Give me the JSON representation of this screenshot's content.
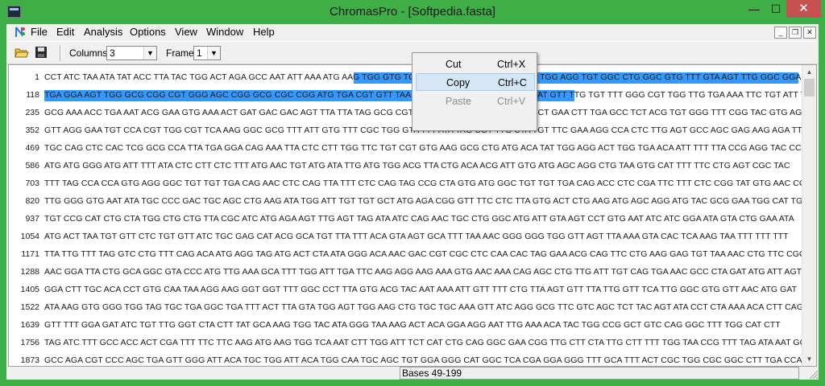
{
  "window": {
    "title": "ChromasPro - [Softpedia.fasta]"
  },
  "titlebar_buttons": {
    "minimize": "—",
    "maximize": "☐",
    "close": "✕"
  },
  "menubar": {
    "items": [
      "File",
      "Edit",
      "Analysis",
      "Options",
      "View",
      "Window",
      "Help"
    ],
    "mdi_buttons": {
      "minimize": "_",
      "restore": "❐",
      "close": "✕"
    }
  },
  "toolbar": {
    "columns_label": "Columns",
    "columns_value": "3",
    "frame_label": "Frame",
    "frame_value": "1",
    "combo_arrow": "▼"
  },
  "sequence": {
    "rows": [
      {
        "num": "1",
        "text": "CCT ATC TAA ATA TAT ACC TTA TAC TGG ACT AGA GCC AAT ATT AAA ATG AAG TGG GTG TCC CGA TGT ACT TTG ATT CGG TGG AGG TGT GGC CTG GGC GTG TTT GTA AGT TTG GGC GGA"
      },
      {
        "num": "118",
        "text": "TGA GGA AGT TGG GCG CGG CGT GGG AGC CGG GCG CGC CGG ATG TGA CGT GTT TAA CGC CCG TGA CAT AGT GCT TAT GTT TTG TGT TTT GGG CGT TGG TTG TGA AAA TTC TGT ATT TTT GGC"
      },
      {
        "num": "235",
        "text": "GCG AAA ACC TGA AAT ACG GAA GTG AAA ACT GAT GAC GAC AGT TTA TTA TAG GCG CGT AAT ATT TGT CTA GGG CCG CCT GAA CTT TGA GCC TCT ACG TGT GGG TTT CGG TAC GTG AGT"
      },
      {
        "num": "352",
        "text": "GTT AGG GAA TGT CCA CGT TGG CGT TCA AAG GGC GCG TTT ATT GTG TTT CGC TGG GTA TTT ATA TAG CGT TTG CTA TGT TTC GAA AGG CCA CTC TTG AGT GCC AGC GAG AAG AGA TTT CTC"
      },
      {
        "num": "469",
        "text": "TGC CAG CTC CAC TCG GCG CCA TTA TGA GGA CAG AAA TTA CTC CTT TGG TTC TGT CGT GTG AAG GCG CTG ATG ACA TAT TGG AGG ACT TGG TGA ACA ATT TTT TTA CCG AGG TAC CCG"
      },
      {
        "num": "586",
        "text": "ATG ATG GGG ATG ATT TTT ATA CTC CTT CTC TTT ATG AAC TGT ATG ATA TTG ATG TGG ACG TTA CTG ACA ACG ATT GTG ATG AGC AGG CTG TAA GTG CAT TTT TTC CTG AGT CGC TAC"
      },
      {
        "num": "703",
        "text": "TTT TAG CCA CCA GTG AGG GGC TGT TGT TGA CAG AAC CTC CAG TTA TTT CTC CAG TAG CCG CTA GTG ATG GGC TGT TGT TGA CAG ACC CTC CGA TTC TTT CTC CGG TAT GTG AAC CCG"
      },
      {
        "num": "820",
        "text": "TTG GGG GTG AAT ATA TGC CCC GAC TGC AGC CTG AAG ATA TGG ATT TGT TGT GCT ATG AGA CGG GTT TTC CTC TTA GTG ACT CTG AAG ATG AGC AGG ATG TAC GCG GAA TGG CAT TGG"
      },
      {
        "num": "937",
        "text": "TGT CCG CAT CTG CTA TGG CTG CTG TTA CGC ATC ATG AGA AGT TTG AGT TAG ATA ATC CAG AAC TGC CTG GGC ATG ATT GTA AGT CCT GTG AAT ATC ATC GGA ATA GTA CTG GAA ATA"
      },
      {
        "num": "1054",
        "text": "ATG ACT TAA TGT GTT CTC TGT GTT ATC TGC GAG CAT ACG GCA TGT TTA TTT ACA GTA AGT GCA TTT TAA AAC GGG GGG TGG GTT AGT TTA AAA GTA CAC TCA AAG TAA TTT TTT TTT"
      },
      {
        "num": "1171",
        "text": "TTA TTG TTT TAG GTC CTG TTT CAG ACA ATG AGG TAG ATG ACT CTA ATA GGG ACA AAC GAC CGT CGC CTC CAA CAC TAG GAA ACG CAG TTC CTG AAG GAG TGT TAA AAC CTG TTC CGC"
      },
      {
        "num": "1288",
        "text": "AAC GGA TTA CTG GCA GGC GTA CCC ATG TTG AAA GCA TTT TGG ATT TGA TTC AAG AGG AAG AAA GTG AAC AAA CAG AGC CTG TTG ATT TGT CAG TGA AAC GCC CTA GAT ATG ATT AGT"
      },
      {
        "num": "1405",
        "text": "GGA CTT TGC ACA CCT GTG CAA TAA AGG AAG GGT GGT TTT GGC CCT TTA GTG ACG TAC AAT AAA ATT GTT TTT CTG TTA AGT GTT TTA TTG GTT TCA TTG GGC GTG GTT AAC ATG GAT"
      },
      {
        "num": "1522",
        "text": "ATA AAG GTG GGG TGG TAG TGC TGA GGC TGA TTT ACT TTA GTA TGG AGT TGG AAG CTG TGC TGC AAA GTT ATC AGG GCG TTC GTC AGC TCT TAC AGT ATA CCT CTA AAA ACA CTT CAG"
      },
      {
        "num": "1639",
        "text": "GTT TTT GGA GAT ATC TGT TTG GGT CTA CTT TAT GCA AAG TGG TAC ATA GGG TAA AAG ACT ACA GGA AGG AAT TTG AAA ACA TAC TGG CCG GCT GTC CAG GGC TTT TGG CAT CTT"
      },
      {
        "num": "1756",
        "text": "TAG ATC TTT GCC ACC ACT CGA TTT TTC TTC AAG ATG AAG TGG TCA AAT CTT TGG ATT TCT CAT CTG CAG GGC GAA CGG TTG CTT CTA TTG CTT TTT TGG TAA CCG TTT TAG ATA AAT GGA"
      },
      {
        "num": "1873",
        "text": "GCC AGA CGT CCC AGC TGA GTT GGG ATT ACA TGC TGG ATT ACA TGG CAA TGC AGC TGT GGA GGG CAT GGC TCA CGA GGA GGG TTT GCA TTT ACT CGC TGG CGC GGC CTT TGA CCA TGC"
      }
    ]
  },
  "context_menu": {
    "items": [
      {
        "label": "Cut",
        "shortcut": "Ctrl+X"
      },
      {
        "label": "Copy",
        "shortcut": "Ctrl+C"
      },
      {
        "label": "Paste",
        "shortcut": "Ctrl+V"
      }
    ]
  },
  "statusbar": {
    "text": "Bases 49-199"
  },
  "colors": {
    "window_frame": "#3fae47",
    "selection": "#3399ff",
    "close_button": "#c75050"
  }
}
